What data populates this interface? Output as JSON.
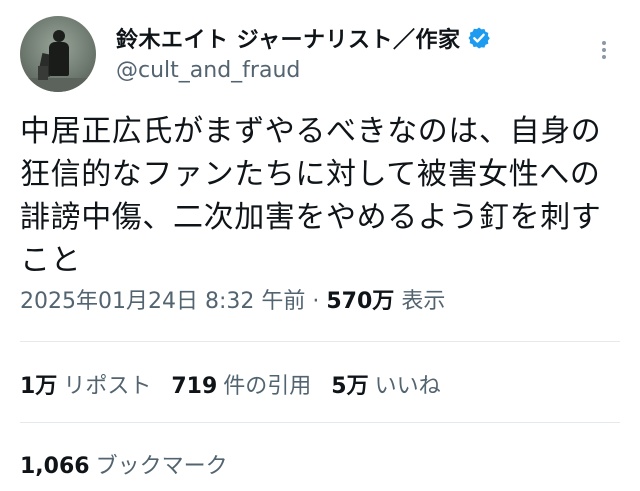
{
  "author": {
    "display_name": "鈴木エイト ジャーナリスト／作家",
    "handle": "@cult_and_fraud",
    "verified": true,
    "verified_color": "#1d9bf0"
  },
  "tweet": {
    "text": "中居正広氏がまずやるべきなのは、自身の狂信的なファンたちに対して被害女性への誹謗中傷、二次加害をやめるよう釘を刺すこと",
    "date": "2025年01月24日 8:32 午前",
    "separator": "·",
    "views": "570万",
    "views_label": "表示"
  },
  "stats": {
    "reposts": {
      "value": "1万",
      "label": "リポスト"
    },
    "quotes": {
      "value": "719",
      "label": "件の引用"
    },
    "likes": {
      "value": "5万",
      "label": "いいね"
    },
    "bookmarks": {
      "value": "1,066",
      "label": "ブックマーク"
    }
  },
  "icons": {
    "more": "more-dots-icon",
    "verified": "verified-badge-icon"
  },
  "colors": {
    "text_primary": "#0f1419",
    "text_secondary": "#536471",
    "divider": "#e6e9eb"
  }
}
